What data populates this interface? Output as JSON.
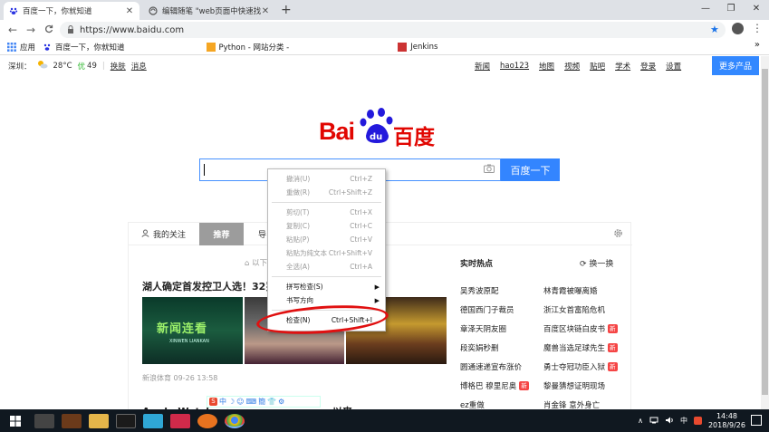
{
  "window": {
    "tabs": [
      {
        "label": "百度一下，你就知道",
        "active": true
      },
      {
        "label": "编辑随笔 \"web页面中快速找到\"",
        "active": false
      }
    ],
    "controls": {
      "minimize": "—",
      "restore": "❐",
      "close": "✕"
    }
  },
  "toolbar": {
    "back": "←",
    "forward": "→",
    "reload": "C",
    "url": "https://www.baidu.com",
    "lock": "🔒",
    "star": "★",
    "menu": "⋮"
  },
  "bookmarks": {
    "items": [
      "应用",
      "百度一下，你就知道",
      "Python - 网站分类 -",
      "Jenkins"
    ],
    "more": "»"
  },
  "baidu_top": {
    "city": "深圳：",
    "weather_icon": "partly-cloudy-icon",
    "temp": "28°C",
    "aqi_label": "优",
    "aqi": "49",
    "skin": "换肤",
    "msg": "消息",
    "nav": [
      "新闻",
      "hao123",
      "地图",
      "视频",
      "贴吧",
      "学术",
      "登录",
      "设置"
    ],
    "more_products": "更多产品"
  },
  "logo": {
    "bai": "Bai",
    "du": "du",
    "baidu": "百度"
  },
  "search": {
    "value": "",
    "button": "百度一下",
    "camera": "📷"
  },
  "panel": {
    "tabs": {
      "follow": "我的关注",
      "recommend": "推荐",
      "nav": "导"
    },
    "refresh_tip": "以下",
    "headline": "湖人确定首发控卫人选！32岁",
    "news_image_title": "新闻连看",
    "news_image_sub": "XINWEN LIANKAN",
    "news_source": "新浪体育",
    "news_time": "09-26 13:58",
    "next_headline": "Apple Watch",
    "next_headline_tail": "以来"
  },
  "hot": {
    "title": "实时热点",
    "swap": "换一换",
    "rows": [
      [
        "吴秀波原配",
        "林青霞被曝离婚"
      ],
      [
        "德国西门子裁员",
        "浙江女首富陷危机"
      ],
      [
        "章泽天阴友圈",
        "百度区块链白皮书"
      ],
      [
        "段奕娟秒删",
        "魔兽当选足球先生"
      ],
      [
        "圆通速递宣布涨价",
        "勇士夺冠功臣入狱"
      ],
      [
        "博格巴 穆里尼奥",
        "黎曼猜想证明现场"
      ],
      [
        "ez重做",
        "肖金锋 意外身亡"
      ]
    ],
    "new_badges": [
      "百度区块链白皮书",
      "魔兽当选足球先生",
      "勇士夺冠功臣入狱",
      "博格巴 穆里尼奥"
    ],
    "new_label": "新"
  },
  "context_menu": {
    "items": [
      {
        "label": "撤消(U)",
        "shortcut": "Ctrl+Z",
        "enabled": false
      },
      {
        "label": "重做(R)",
        "shortcut": "Ctrl+Shift+Z",
        "enabled": false
      },
      {
        "label": "剪切(T)",
        "shortcut": "Ctrl+X",
        "enabled": false
      },
      {
        "label": "复制(C)",
        "shortcut": "Ctrl+C",
        "enabled": false
      },
      {
        "label": "粘贴(P)",
        "shortcut": "Ctrl+V",
        "enabled": false
      },
      {
        "label": "粘贴为纯文本",
        "shortcut": "Ctrl+Shift+V",
        "enabled": false
      },
      {
        "label": "全选(A)",
        "shortcut": "Ctrl+A",
        "enabled": false
      },
      {
        "label": "拼写检查(S)",
        "shortcut": "",
        "enabled": true
      },
      {
        "label": "书写方向",
        "shortcut": "",
        "enabled": true
      },
      {
        "label": "检查(N)",
        "shortcut": "Ctrl+Shift+I",
        "enabled": true
      }
    ]
  },
  "ime": {
    "items": [
      "S",
      "中",
      "☽",
      "☺",
      "⌨",
      "簡",
      "👕",
      "⚙"
    ]
  },
  "taskbar": {
    "time": "14:48",
    "date": "2018/9/26",
    "ime_indicator": "中",
    "tray_chevron": "∧"
  },
  "colors": {
    "baidu_red": "#e10601",
    "baidu_blue": "#3385ff",
    "annotation_red": "#e01010"
  }
}
